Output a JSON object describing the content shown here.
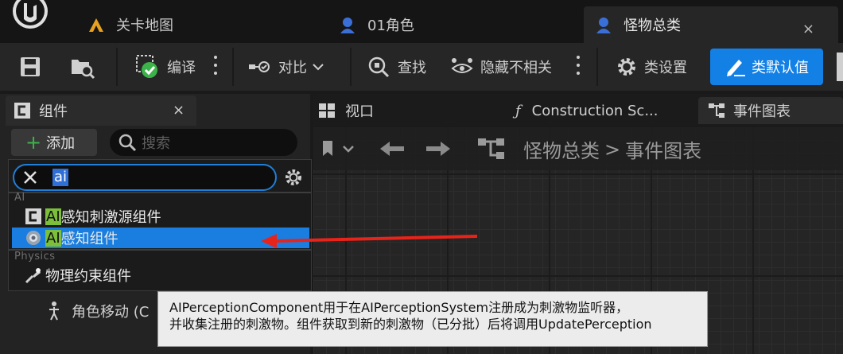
{
  "titlebar": {
    "tabs": [
      {
        "label": "关卡地图",
        "icon": "level-map-icon"
      },
      {
        "label": "01角色",
        "icon": "character-blueprint-icon"
      },
      {
        "label": "怪物总类",
        "icon": "monster-blueprint-icon"
      }
    ],
    "close_glyph": "×"
  },
  "toolbar": {
    "compile": "编译",
    "diff": "对比",
    "find": "查找",
    "hide_unrelated": "隐藏不相关",
    "class_settings": "类设置",
    "class_defaults": "类默认值"
  },
  "components_panel": {
    "title": "组件",
    "close_glyph": "×",
    "add_label": "添加",
    "search_placeholder": "搜索"
  },
  "dropdown": {
    "query": "ai",
    "categories": [
      {
        "name": "AI",
        "items": [
          {
            "highlight": "AI",
            "rest": "感知刺激源组件",
            "icon": "component-c-icon",
            "selected": false
          },
          {
            "highlight": "AI",
            "rest": "感知组件",
            "icon": "perception-icon",
            "selected": true
          }
        ]
      },
      {
        "name": "Physics",
        "items": [
          {
            "highlight": "",
            "rest": "物理约束组件",
            "icon": "physics-constraint-icon",
            "selected": false
          }
        ]
      }
    ]
  },
  "below_item": "角色移动 (C",
  "viewport_tabs": {
    "viewport": "视口",
    "construction": "Construction Sc...",
    "event_graph": "事件图表"
  },
  "breadcrumb": {
    "root": "怪物总类",
    "separator": ">",
    "current": "事件图表"
  },
  "tooltip": {
    "line1": "AIPerceptionComponent用于在AIPerceptionSystem注册成为刺激物监听器，",
    "line2": "并收集注册的刺激物。组件获取到新的刺激物（已分批）后将调用UpdatePerception"
  },
  "colors": {
    "accent_blue": "#1380e6",
    "selection_blue": "#1a7ee0",
    "match_highlight": "#7bbf3a",
    "annotation_arrow": "#e8231a"
  }
}
